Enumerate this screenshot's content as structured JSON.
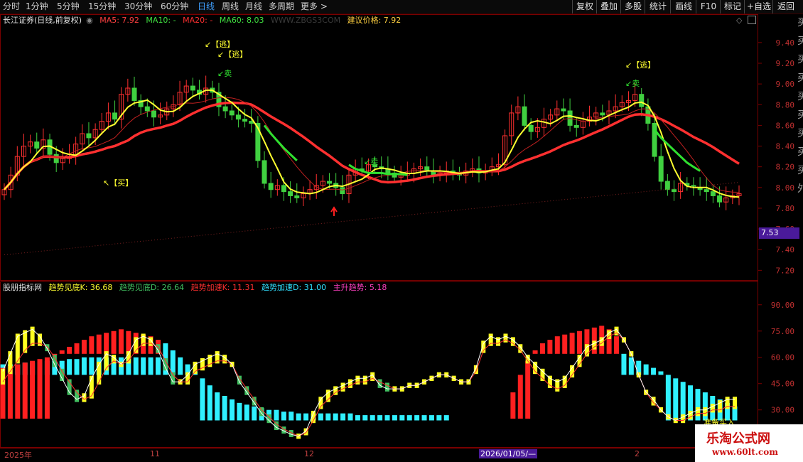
{
  "toolbar": {
    "tabs": [
      "分时",
      "1分钟",
      "5分钟",
      "15分钟",
      "30分钟",
      "60分钟",
      "日线",
      "周线",
      "月线",
      "多周期",
      "更多 >"
    ],
    "active_tab": "日线",
    "buttons": [
      "复权",
      "叠加",
      "多股",
      "统计",
      "画线",
      "F10",
      "标记",
      "+自选",
      "返回"
    ]
  },
  "main_chart": {
    "title": "长江证券(日线,前复权)",
    "ma": [
      {
        "label": "MA5: 7.92",
        "color": "#ff4040"
      },
      {
        "label": "MA10: -",
        "color": "#ffffff"
      },
      {
        "label": "MA20: -",
        "color": "#ff4040"
      },
      {
        "label": "MA60: 8.03",
        "color": "#40e040"
      }
    ],
    "source_text": "WWW.ZBGS3COM",
    "suggest_label": "建议价格: 7.92",
    "signals": {
      "escape": "【逃】",
      "sell": "卖",
      "buy": "【买】"
    },
    "price_badge": "7.53"
  },
  "indicator": {
    "title": "股朋指标网",
    "lines": [
      {
        "label": "趋势见底K: 36.68",
        "color": "#ffff30"
      },
      {
        "label": "趋势见底D: 26.64",
        "color": "#40c060"
      },
      {
        "label": "趋势加速K: 11.31",
        "color": "#ff3030"
      },
      {
        "label": "趋势加速D: 31.00",
        "color": "#30e0ff"
      },
      {
        "label": "主升趋势: 5.18",
        "color": "#ff40c0"
      }
    ],
    "bottom_label": "准备买入"
  },
  "x_axis_labels": [
    "2025年",
    "11",
    "12",
    "2026/01/05/—",
    "2"
  ],
  "watermark": {
    "title": "乐淘公式网",
    "url": "www.60lt.com"
  },
  "chart_data": [
    {
      "type": "candlestick",
      "title": "长江证券(日线,前复权)",
      "y_ticks": [
        9.4,
        9.2,
        9.0,
        8.8,
        8.6,
        8.4,
        8.2,
        8.0,
        7.8,
        7.6,
        7.4,
        7.2
      ],
      "ylim": [
        7.12,
        9.55
      ],
      "series": [
        {
          "name": "MA5",
          "color": "#ffff30"
        },
        {
          "name": "MA20",
          "color": "#ff4040"
        },
        {
          "name": "MA60",
          "color": "#40e040"
        }
      ],
      "close": [
        7.98,
        8.12,
        8.3,
        8.4,
        8.44,
        8.38,
        8.46,
        8.32,
        8.24,
        8.28,
        8.3,
        8.42,
        8.52,
        8.48,
        8.56,
        8.64,
        8.72,
        8.66,
        8.9,
        8.96,
        8.84,
        8.78,
        8.74,
        8.68,
        8.7,
        8.76,
        8.8,
        8.92,
        8.98,
        8.94,
        8.9,
        8.96,
        8.92,
        8.78,
        8.74,
        8.7,
        8.66,
        8.64,
        8.62,
        8.26,
        8.04,
        7.98,
        8.02,
        7.96,
        7.92,
        7.9,
        7.94,
        7.98,
        8.02,
        8.06,
        8.04,
        8.0,
        7.94,
        8.12,
        8.18,
        8.16,
        8.22,
        8.2,
        8.18,
        8.14,
        8.1,
        8.12,
        8.14,
        8.18,
        8.2,
        8.16,
        8.12,
        8.14,
        8.16,
        8.14,
        8.12,
        8.16,
        8.18,
        8.14,
        8.16,
        8.2,
        8.22,
        8.5,
        8.72,
        8.78,
        8.6,
        8.54,
        8.58,
        8.66,
        8.7,
        8.76,
        8.74,
        8.6,
        8.58,
        8.64,
        8.68,
        8.72,
        8.7,
        8.74,
        8.78,
        8.82,
        8.84,
        8.9,
        8.78,
        8.62,
        8.3,
        8.06,
        7.98,
        7.96,
        8.04,
        8.02,
        8.0,
        7.98,
        7.96,
        7.92,
        7.86,
        7.9,
        7.92,
        7.94
      ],
      "sell_line": [
        8.34,
        8.33,
        8.33,
        8.32,
        8.32,
        8.31,
        8.31,
        8.3,
        8.3,
        8.3,
        8.29,
        8.29,
        8.28,
        8.28,
        8.27,
        8.27,
        8.26,
        8.26,
        8.25,
        8.25,
        8.24,
        8.24,
        8.23,
        8.23,
        8.22,
        8.22,
        8.21,
        8.21,
        8.2,
        8.2,
        8.19,
        8.19,
        8.18,
        8.18,
        8.17,
        8.17,
        8.16,
        8.16,
        8.15,
        8.15,
        8.14,
        8.14,
        8.14,
        8.13,
        8.13,
        8.13,
        8.13,
        8.12,
        8.12,
        8.12,
        8.12,
        8.12,
        8.11,
        8.11,
        8.11,
        8.11,
        8.11
      ]
    },
    {
      "type": "bar",
      "title": "股朋指标网",
      "y_ticks": [
        90.0,
        75.0,
        60.0,
        45.0,
        30.0,
        15.0
      ],
      "ylim": [
        10,
        96
      ],
      "series": [
        {
          "name": "趋势见底K",
          "values": [
            52,
            62,
            72,
            74,
            76,
            72,
            65,
            56,
            48,
            40,
            36,
            38,
            48,
            56,
            62,
            60,
            56,
            62,
            70,
            72,
            70,
            64,
            54,
            46,
            46,
            50,
            56,
            58,
            60,
            62,
            60,
            56,
            46,
            40,
            34,
            28,
            24,
            20,
            18,
            16,
            15,
            18,
            28,
            36,
            40,
            42,
            44,
            46,
            48,
            48,
            50,
            44,
            42,
            42,
            42,
            44,
            44,
            46,
            48,
            50,
            50,
            48,
            46,
            46,
            54,
            68,
            72,
            70,
            72,
            70,
            66,
            60,
            56,
            52,
            48,
            46,
            48,
            54,
            60,
            66,
            68,
            70,
            74,
            76,
            70,
            62,
            50,
            40,
            36,
            30,
            26,
            24,
            26,
            28,
            30,
            30,
            32,
            34,
            36,
            36
          ]
        },
        {
          "name": "趋势见底D",
          "values": [
            46,
            52,
            58,
            64,
            68,
            68,
            66,
            60,
            52,
            46,
            40,
            36,
            38,
            46,
            54,
            58,
            56,
            58,
            64,
            68,
            68,
            66,
            58,
            50,
            46,
            46,
            52,
            54,
            56,
            58,
            58,
            56,
            48,
            42,
            36,
            30,
            26,
            22,
            19,
            17,
            15,
            17,
            24,
            32,
            36,
            40,
            42,
            44,
            46,
            46,
            48,
            46,
            44,
            42,
            42,
            44,
            44,
            46,
            48,
            50,
            50,
            48,
            46,
            46,
            52,
            64,
            68,
            68,
            70,
            68,
            64,
            58,
            52,
            48,
            44,
            42,
            44,
            50,
            56,
            62,
            66,
            68,
            72,
            74,
            70,
            62,
            50,
            40,
            34,
            30,
            26,
            24,
            24,
            26,
            28,
            28,
            30,
            30,
            32,
            32
          ]
        },
        {
          "name": "趋势加速K",
          "values": [
            54,
            55,
            56,
            57,
            58,
            59,
            60,
            62,
            64,
            66,
            68,
            70,
            72,
            73,
            74,
            75,
            76,
            75,
            74,
            73,
            72,
            70,
            0,
            0,
            0,
            0,
            0,
            0,
            0,
            0,
            0,
            0,
            0,
            0,
            0,
            0,
            0,
            0,
            0,
            0,
            0,
            0,
            0,
            0,
            0,
            0,
            0,
            0,
            0,
            0,
            0,
            0,
            0,
            0,
            0,
            0,
            0,
            0,
            0,
            0,
            0,
            0,
            0,
            0,
            0,
            0,
            0,
            0,
            0,
            40,
            50,
            58,
            64,
            68,
            70,
            72,
            73,
            74,
            75,
            76,
            77,
            78,
            76,
            72,
            0,
            0,
            0,
            0,
            0,
            0,
            0,
            0,
            0,
            0,
            0,
            0,
            0,
            0,
            0,
            0
          ]
        },
        {
          "name": "趋势加速D",
          "values": [
            56,
            56,
            56,
            57,
            57,
            57,
            58,
            58,
            58,
            59,
            59,
            60,
            60,
            60,
            60,
            60,
            60,
            60,
            60,
            60,
            60,
            60,
            68,
            64,
            60,
            56,
            52,
            48,
            44,
            40,
            38,
            36,
            34,
            33,
            32,
            31,
            30,
            30,
            29,
            29,
            28,
            28,
            28,
            28,
            28,
            28,
            28,
            28,
            27,
            27,
            27,
            27,
            27,
            27,
            27,
            27,
            27,
            27,
            27,
            27,
            27,
            0,
            0,
            0,
            0,
            0,
            0,
            0,
            0,
            0,
            0,
            0,
            0,
            0,
            0,
            0,
            0,
            0,
            0,
            0,
            0,
            0,
            0,
            0,
            62,
            60,
            58,
            56,
            54,
            52,
            50,
            48,
            46,
            44,
            42,
            40,
            38,
            36,
            34,
            32
          ]
        }
      ]
    }
  ]
}
